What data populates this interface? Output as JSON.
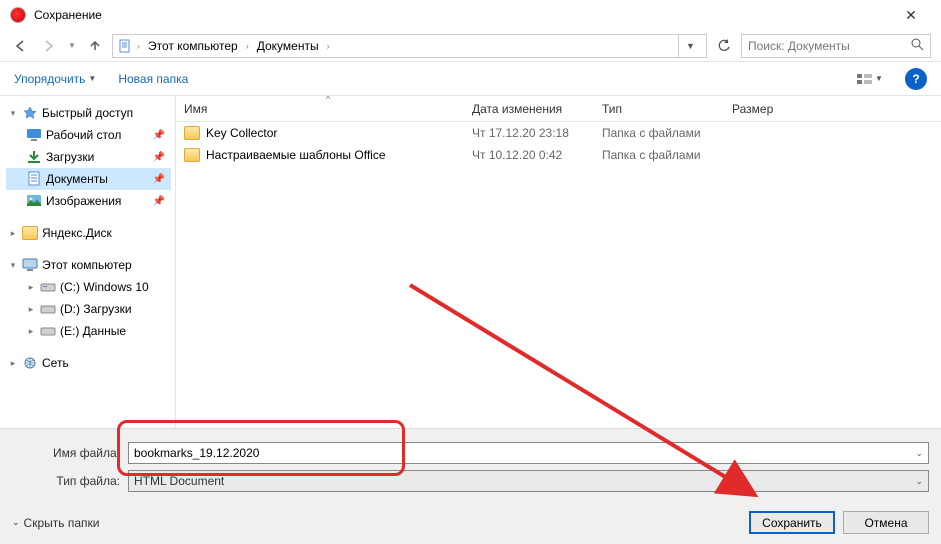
{
  "title": "Сохранение",
  "breadcrumb": {
    "root": "Этот компьютер",
    "folder": "Документы"
  },
  "search": {
    "placeholder": "Поиск: Документы"
  },
  "toolbar": {
    "organize": "Упорядочить",
    "new_folder": "Новая папка"
  },
  "tree": {
    "quick_access": "Быстрый доступ",
    "desktop": "Рабочий стол",
    "downloads": "Загрузки",
    "documents": "Документы",
    "pictures": "Изображения",
    "yandex": "Яндекс.Диск",
    "this_pc": "Этот компьютер",
    "c_drive": "(C:) Windows 10",
    "d_drive": "(D:) Загрузки",
    "e_drive": "(E:) Данные",
    "network": "Сеть"
  },
  "columns": {
    "name": "Имя",
    "date": "Дата изменения",
    "type": "Тип",
    "size": "Размер"
  },
  "rows": [
    {
      "name": "Key Collector",
      "date": "Чт 17.12.20 23:18",
      "type": "Папка с файлами"
    },
    {
      "name": "Настраиваемые шаблоны Office",
      "date": "Чт 10.12.20 0:42",
      "type": "Папка с файлами"
    }
  ],
  "form": {
    "filename_label": "Имя файла:",
    "filetype_label": "Тип файла:",
    "filename": "bookmarks_19.12.2020",
    "filetype": "HTML Document"
  },
  "footer": {
    "hide_folders": "Скрыть папки",
    "save": "Сохранить",
    "cancel": "Отмена"
  }
}
